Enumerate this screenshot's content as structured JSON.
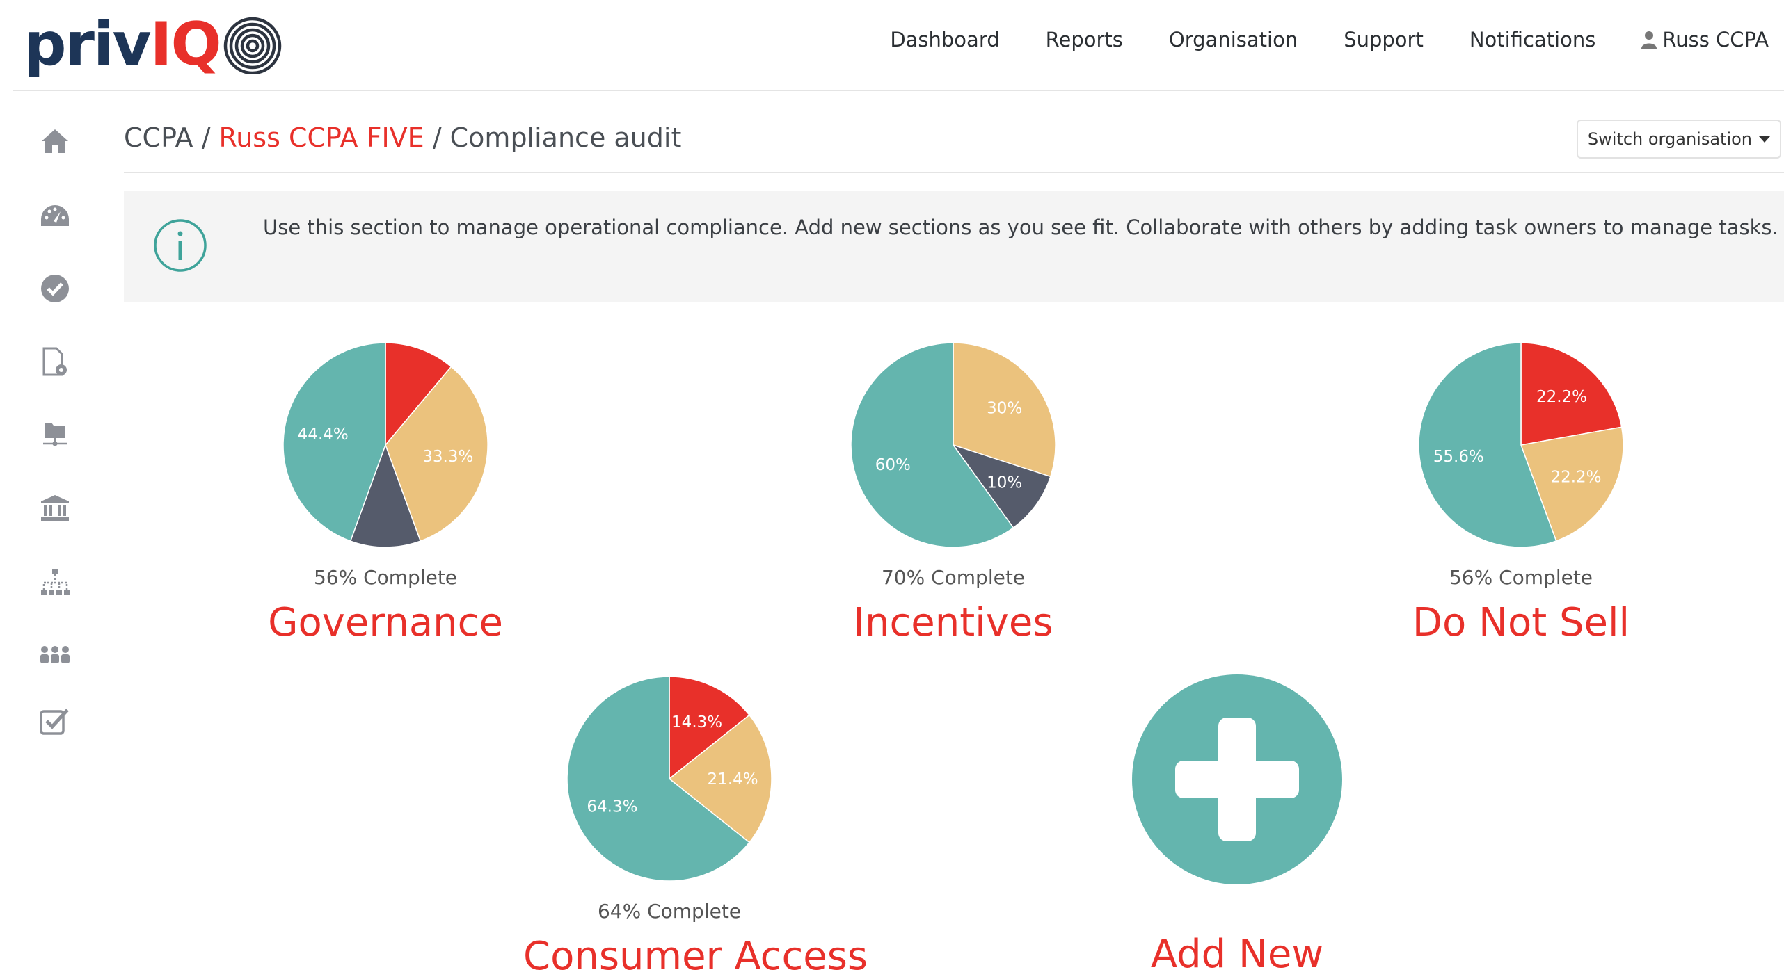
{
  "brand": {
    "logo_part1": "priv",
    "logo_part2": "IQ"
  },
  "topnav": {
    "items": [
      "Dashboard",
      "Reports",
      "Organisation",
      "Support",
      "Notifications"
    ],
    "user_label": "Russ CCPA"
  },
  "sidebar": {
    "icons": [
      "home-icon",
      "dashboard-gauge-icon",
      "check-circle-icon",
      "document-settings-icon",
      "folder-network-icon",
      "bank-icon",
      "sitemap-icon",
      "team-icon",
      "checkbox-icon"
    ]
  },
  "breadcrumb": {
    "root": "CCPA",
    "separator1": " / ",
    "organisation": "Russ CCPA FIVE",
    "separator2": " / ",
    "current": "Compliance audit"
  },
  "switch_org": {
    "label": "Switch organisation"
  },
  "info": {
    "text": "Use this section to manage operational compliance. Add new sections as you see fit. Collaborate with others by adding task owners to manage tasks."
  },
  "colors": {
    "teal": "#64b5ae",
    "red": "#e8302a",
    "amber": "#ebc27d",
    "slate": "#555b6b",
    "brand_navy": "#1d3557"
  },
  "chart_data": [
    {
      "type": "pie",
      "title": "Governance",
      "caption": "56% Complete",
      "slices": [
        {
          "value": 11.1,
          "color": "red",
          "label": ""
        },
        {
          "value": 33.3,
          "color": "amber",
          "label": "33.3%"
        },
        {
          "value": 11.1,
          "color": "slate",
          "label": ""
        },
        {
          "value": 44.4,
          "color": "teal",
          "label": "44.4%"
        }
      ]
    },
    {
      "type": "pie",
      "title": "Incentives",
      "caption": "70% Complete",
      "slices": [
        {
          "value": 30,
          "color": "amber",
          "label": "30%"
        },
        {
          "value": 10,
          "color": "slate",
          "label": "10%"
        },
        {
          "value": 60,
          "color": "teal",
          "label": "60%"
        }
      ]
    },
    {
      "type": "pie",
      "title": "Do Not Sell",
      "caption": "56% Complete",
      "slices": [
        {
          "value": 22.2,
          "color": "red",
          "label": "22.2%"
        },
        {
          "value": 22.2,
          "color": "amber",
          "label": "22.2%"
        },
        {
          "value": 55.6,
          "color": "teal",
          "label": "55.6%"
        }
      ]
    },
    {
      "type": "pie",
      "title": "Consumer Access",
      "caption": "64% Complete",
      "slices": [
        {
          "value": 14.3,
          "color": "red",
          "label": "14.3%"
        },
        {
          "value": 21.4,
          "color": "amber",
          "label": "21.4%"
        },
        {
          "value": 64.3,
          "color": "teal",
          "label": "64.3%"
        }
      ]
    }
  ],
  "add_new": {
    "label": "Add New"
  }
}
